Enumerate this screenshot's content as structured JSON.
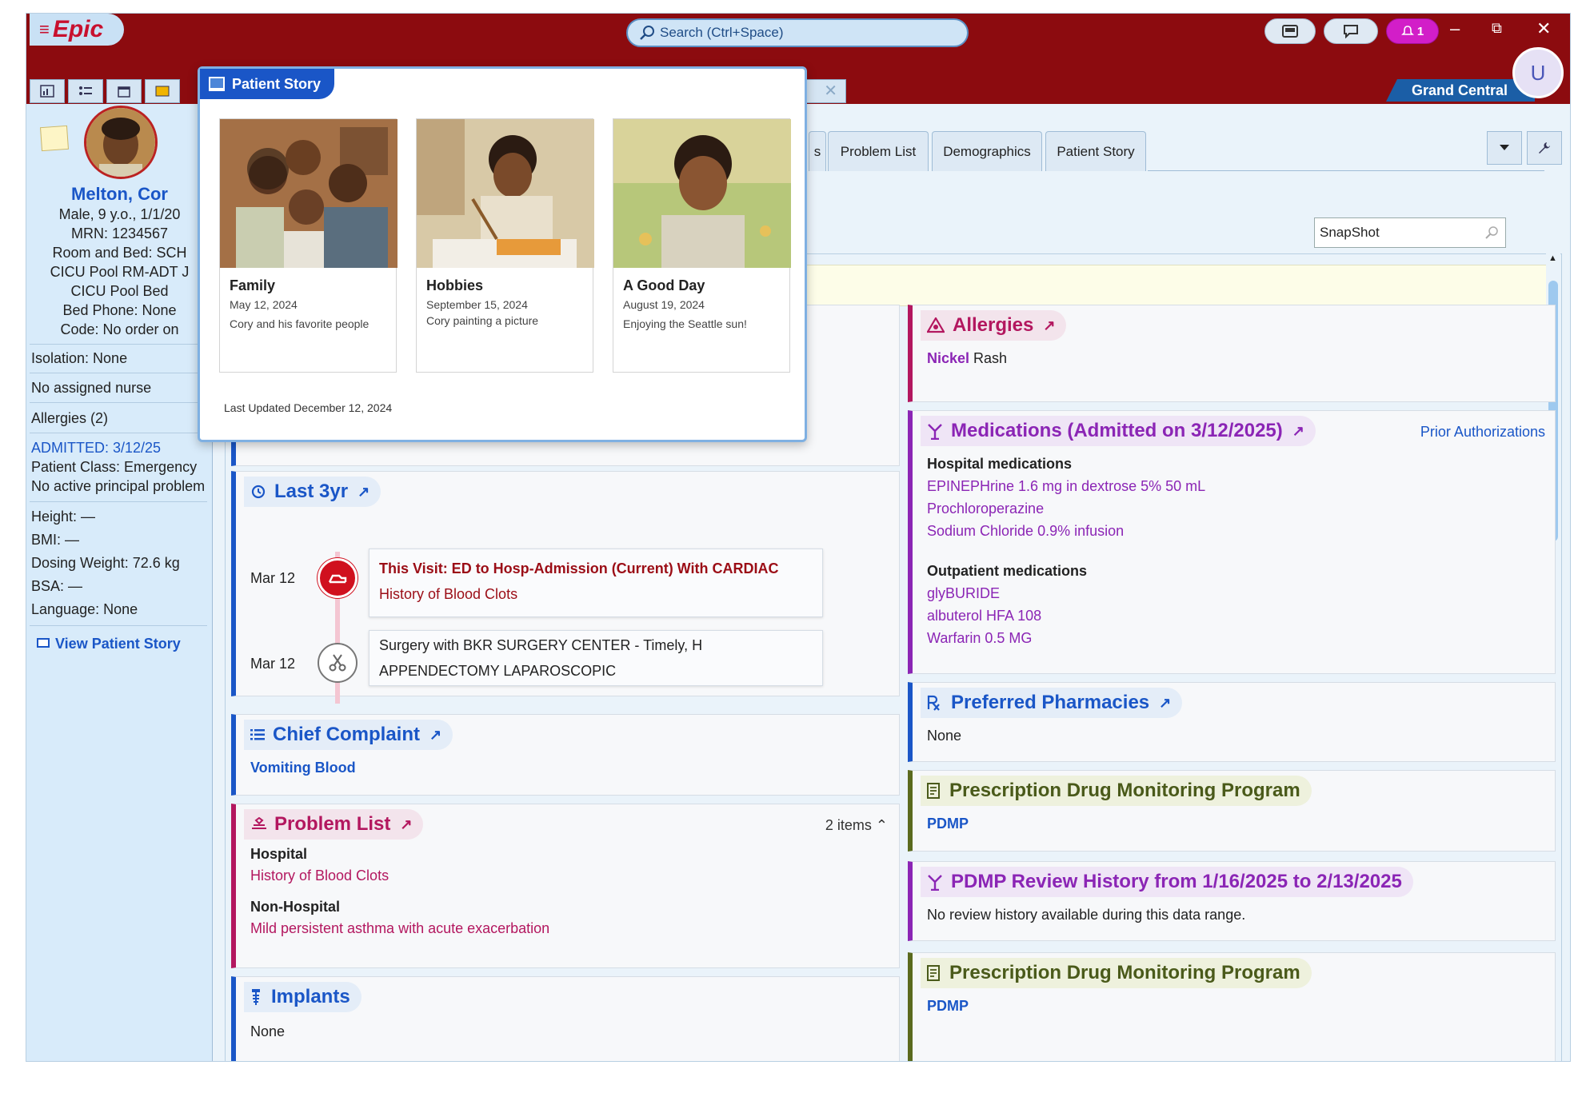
{
  "app": {
    "logo": "Epic",
    "search_placeholder": "Search (Ctrl+Space)",
    "notif_count": "1",
    "location": "Grand Central",
    "user_initial": "U"
  },
  "patient": {
    "name": "Melton, Cor",
    "line1": "Male, 9 y.o., 1/1/20",
    "mrn": "MRN: 1234567",
    "room": "Room and Bed: SCH",
    "pool1": "CICU Pool RM-ADT J",
    "pool2": "CICU Pool Bed",
    "phone": "Bed Phone: None",
    "code": "Code: No order on",
    "isolation": "Isolation: None",
    "nurse": "No assigned nurse",
    "allergies": "Allergies (2)",
    "admitted": "ADMITTED: 3/12/25",
    "pclass": "Patient Class: Emergency",
    "principal": "No active principal problem",
    "height": "Height: —",
    "bmi": "BMI: —",
    "dosing": "Dosing Weight: 72.6 kg",
    "bsa": "BSA: —",
    "language": "Language: None",
    "view_story": "View Patient Story"
  },
  "tabs": {
    "partial": "s",
    "problem_list": "Problem List",
    "demographics": "Demographics",
    "patient_story": "Patient Story"
  },
  "snapshot": {
    "value": "SnapShot"
  },
  "story": {
    "title": "Patient Story",
    "cards": [
      {
        "title": "Family",
        "date": "May 12, 2024",
        "caption": "Cory and his favorite people"
      },
      {
        "title": "Hobbies",
        "date": "September 15, 2024",
        "caption": "Cory painting a picture"
      },
      {
        "title": "A Good Day",
        "date": "August 19, 2024",
        "caption": "Enjoying the Seattle sun!"
      }
    ],
    "updated": "Last Updated December 12, 2024"
  },
  "last3yr": {
    "title": "Last 3yr",
    "events": [
      {
        "date": "Mar 12",
        "title": "This Visit: ED to Hosp-Admission (Current) With CARDIAC",
        "sub": "History of Blood Clots"
      },
      {
        "date": "Mar 12",
        "title": "Surgery with BKR SURGERY CENTER - Timely, H",
        "sub": "APPENDECTOMY LAPAROSCOPIC"
      }
    ]
  },
  "chief": {
    "title": "Chief Complaint",
    "value": "Vomiting Blood"
  },
  "problems": {
    "title": "Problem List",
    "count": "2 items",
    "hospital_label": "Hospital",
    "hospital_item": "History of Blood Clots",
    "nonhosp_label": "Non-Hospital",
    "nonhosp_item": "Mild persistent asthma with acute exacerbation"
  },
  "implants": {
    "title": "Implants",
    "value": "None"
  },
  "allergies": {
    "title": "Allergies",
    "item_bold": "Nickel",
    "item_rest": " Rash"
  },
  "meds": {
    "title": "Medications (Admitted on 3/12/2025)",
    "prior_auth": "Prior Authorizations",
    "hospital_label": "Hospital medications",
    "hospital": [
      "EPINEPHrine 1.6 mg in dextrose 5% 50 mL",
      "Prochloroperazine",
      "Sodium Chloride 0.9% infusion"
    ],
    "outpatient_label": "Outpatient medications",
    "outpatient": [
      "glyBURIDE",
      "albuterol HFA 108",
      "Warfarin 0.5 MG"
    ]
  },
  "pharm": {
    "title": "Preferred Pharmacies",
    "value": "None"
  },
  "pdmp1": {
    "title": "Prescription Drug Monitoring Program",
    "link": "PDMP"
  },
  "pdmp_review": {
    "title": "PDMP Review History from 1/16/2025 to 2/13/2025",
    "text": "No review history available during this data range."
  },
  "pdmp2": {
    "title": "Prescription Drug Monitoring Program",
    "link": "PDMP"
  }
}
